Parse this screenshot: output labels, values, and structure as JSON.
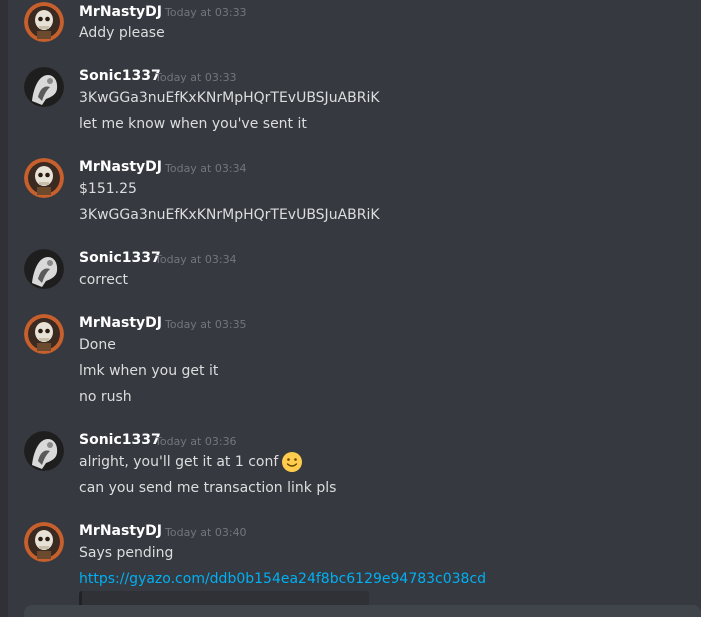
{
  "messages": [
    {
      "user": "MrNastyDJ",
      "time": "Today at 03:33",
      "avatar": "skull-avatar",
      "lines": [
        "Addy please"
      ]
    },
    {
      "user": "Sonic1337",
      "time": "Today at 03:33",
      "avatar": "bw-avatar",
      "lines": [
        "3KwGGa3nuEfKxKNrMpHQrTEvUBSJuABRiK",
        "let me know when you've sent it"
      ]
    },
    {
      "user": "MrNastyDJ",
      "time": "Today at 03:34",
      "avatar": "skull-avatar",
      "lines": [
        "$151.25",
        "3KwGGa3nuEfKxKNrMpHQrTEvUBSJuABRiK"
      ]
    },
    {
      "user": "Sonic1337",
      "time": "Today at 03:34",
      "avatar": "bw-avatar",
      "lines": [
        "correct"
      ]
    },
    {
      "user": "MrNastyDJ",
      "time": "Today at 03:35",
      "avatar": "skull-avatar",
      "lines": [
        "Done",
        "lmk when you get it",
        "no rush"
      ]
    },
    {
      "user": "Sonic1337",
      "time": "Today at 03:36",
      "avatar": "bw-avatar",
      "lines": [
        "alright, you'll get it at 1 conf",
        "can you send me transaction link pls"
      ],
      "emoji": "slight-smile-emoji"
    },
    {
      "user": "MrNastyDJ",
      "time": "Today at 03:40",
      "avatar": "skull-avatar",
      "lines": [
        "Says pending"
      ],
      "link": "https://gyazo.com/ddb0b154ea24f8bc6129e94783c038cd"
    }
  ],
  "colors": {
    "background": "#36393f",
    "username": "#ffffff",
    "text": "#dcddde",
    "timestamp": "#72767d",
    "link": "#00b0f4"
  }
}
